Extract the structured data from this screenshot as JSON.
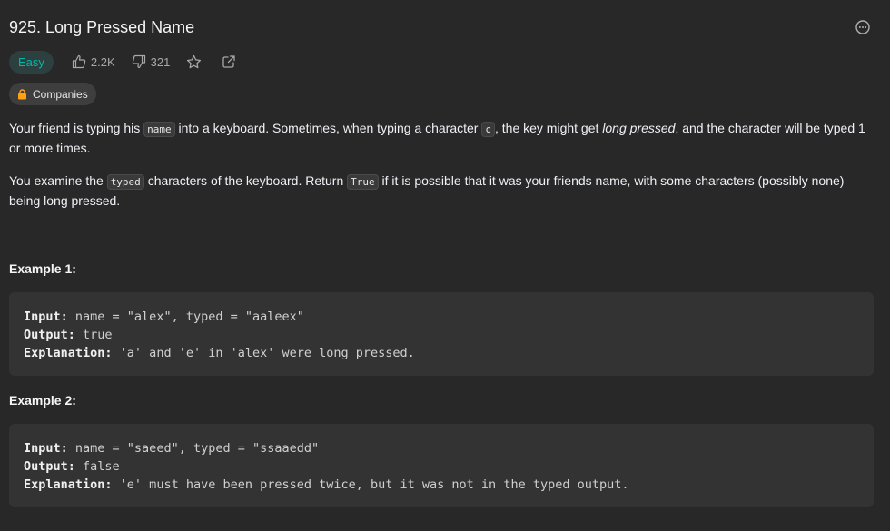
{
  "problem": {
    "title": "925. Long Pressed Name",
    "difficulty": "Easy",
    "likes": "2.2K",
    "dislikes": "321",
    "companies_label": "Companies"
  },
  "description": {
    "p1": {
      "t1": "Your friend is typing his ",
      "code1": "name",
      "t2": " into a keyboard. Sometimes, when typing a character ",
      "code2": "c",
      "t3": ", the key might get ",
      "em": "long pressed",
      "t4": ", and the character will be typed 1 or more times."
    },
    "p2": {
      "t1": "You examine the ",
      "code1": "typed",
      "t2": " characters of the keyboard. Return ",
      "code2": "True",
      "t3": " if it is possible that it was your friends name, with some characters (possibly none) being long pressed."
    }
  },
  "examples": [
    {
      "title": "Example 1:",
      "input_label": "Input:",
      "input": " name = \"alex\", typed = \"aaleex\"",
      "output_label": "Output:",
      "output": " true",
      "explanation_label": "Explanation:",
      "explanation": " 'a' and 'e' in 'alex' were long pressed."
    },
    {
      "title": "Example 2:",
      "input_label": "Input:",
      "input": " name = \"saeed\", typed = \"ssaaedd\"",
      "output_label": "Output:",
      "output": " false",
      "explanation_label": "Explanation:",
      "explanation": " 'e' must have been pressed twice, but it was not in the typed output."
    }
  ],
  "icons": {
    "more": "ellipsis-circle-icon",
    "like": "thumbs-up-icon",
    "dislike": "thumbs-down-icon",
    "favorite": "star-icon",
    "share": "share-icon",
    "lock": "lock-icon"
  },
  "colors": {
    "background": "#282828",
    "difficulty_easy": "#00b8a3",
    "lock": "#ffa116"
  }
}
